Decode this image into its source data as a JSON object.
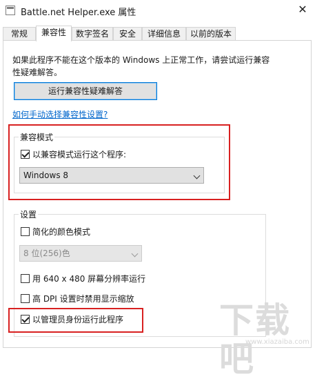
{
  "window": {
    "title": "Battle.net Helper.exe 属性",
    "close_glyph": "✕"
  },
  "tabs": [
    {
      "label": "常规",
      "active": false
    },
    {
      "label": "兼容性",
      "active": true
    },
    {
      "label": "数字签名",
      "active": false
    },
    {
      "label": "安全",
      "active": false
    },
    {
      "label": "详细信息",
      "active": false
    },
    {
      "label": "以前的版本",
      "active": false
    }
  ],
  "compatibility_tab": {
    "intro_text": "如果此程序不能在这个版本的 Windows 上正常工作，请尝试运行兼容性疑难解答。",
    "troubleshoot_button": "运行兼容性疑难解答",
    "manual_link": "如何手动选择兼容性设置?",
    "compat_mode": {
      "legend": "兼容模式",
      "checkbox_label": "以兼容模式运行这个程序:",
      "checkbox_checked": true,
      "selected_os": "Windows 8"
    },
    "settings": {
      "legend": "设置",
      "reduced_color_label": "简化的颜色模式",
      "reduced_color_checked": false,
      "color_depth_value": "8 位(256)色",
      "resolution_label": "用 640 x 480 屏幕分辨率运行",
      "resolution_checked": false,
      "high_dpi_label": "高 DPI 设置时禁用显示缩放",
      "high_dpi_checked": false,
      "admin_label": "以管理员身份运行此程序",
      "admin_checked": true
    }
  },
  "watermark": {
    "glyphs": "下载吧",
    "subtext": "www.xiazaiba.com"
  },
  "colors": {
    "highlight_box": "#d82020",
    "link": "#0066cc",
    "focus_border": "#0078d7"
  },
  "icons": [
    "app-icon",
    "close-icon",
    "chevron-down-icon",
    "checkbox-checked-icon"
  ]
}
